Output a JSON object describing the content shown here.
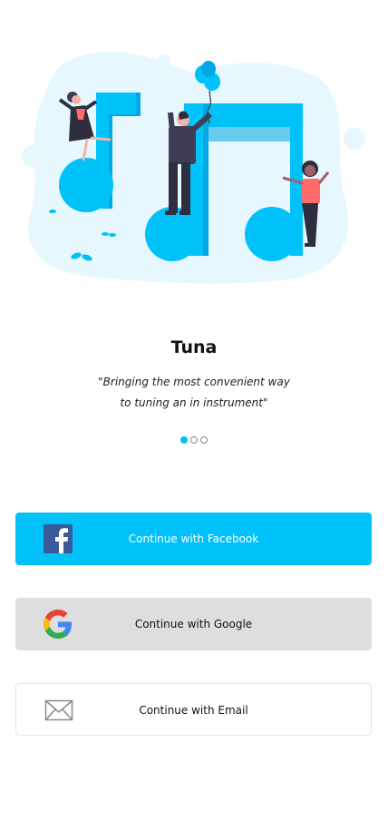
{
  "app": {
    "title": "Tuna",
    "tagline_line1": "\"Bringing the most convenient way",
    "tagline_line2": "to tuning an in instrument\""
  },
  "carousel": {
    "count": 3,
    "active_index": 0
  },
  "buttons": {
    "facebook": {
      "label": "Continue with Facebook",
      "icon": "facebook-icon"
    },
    "google": {
      "label": "Continue with Google",
      "icon": "google-icon"
    },
    "email": {
      "label": "Continue with Email",
      "icon": "mail-icon"
    }
  },
  "colors": {
    "accent": "#00c2f9",
    "blob": "#e6f7fd",
    "google_button_bg": "#dedede",
    "facebook_blue": "#3b5998"
  }
}
